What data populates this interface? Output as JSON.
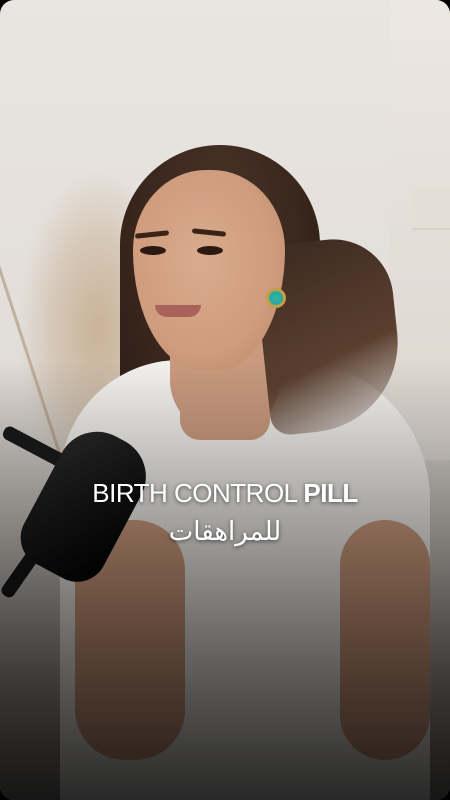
{
  "caption": {
    "title_light": "BIRTH CONTROL",
    "title_bold": "PILL",
    "subtitle": "للمراهقات"
  },
  "colors": {
    "caption_text": "#ffffff",
    "earring_accent": "#2fb5a8"
  },
  "scene": {
    "subject": "woman-speaking",
    "props": [
      "microphone",
      "pampas-grass"
    ]
  }
}
